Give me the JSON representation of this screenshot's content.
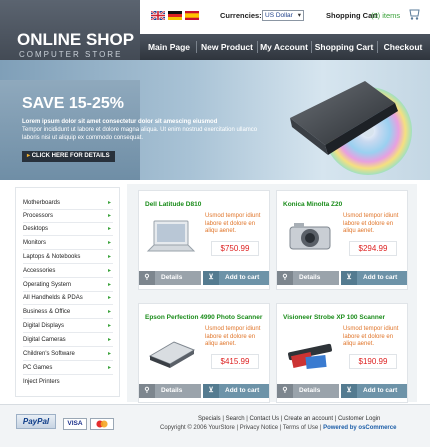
{
  "header": {
    "logo_title": "ONLINE SHOP",
    "logo_subtitle": "COMPUTER STORE",
    "currencies_label": "Currencies:",
    "currency_selected": "US Dollar",
    "cart_label": "Shopping Cart",
    "cart_count": "(0) items",
    "flags": [
      "uk-flag-icon",
      "germany-flag-icon",
      "spain-flag-icon"
    ]
  },
  "nav": {
    "items": [
      {
        "label": "Main Page"
      },
      {
        "label": "New Product"
      },
      {
        "label": "My Account"
      },
      {
        "label": "Shopping Cart"
      },
      {
        "label": "Checkout"
      }
    ]
  },
  "banner": {
    "headline": "SAVE 15-25%",
    "copy_bold": "Lorem ipsum dolor sit amet consectetur dolor sit amescing eiusmod",
    "copy": "Tempor incididunt ut labore et dolore magna aliqua. Ut enim nostrud exercitation ullamco laboris nisi ut aliquip ex commodo consequat.",
    "button": "CLICK HERE FOR DETAILS"
  },
  "sidebar": {
    "items": [
      {
        "label": "Motherboards"
      },
      {
        "label": "Processors"
      },
      {
        "label": "Desktops"
      },
      {
        "label": "Monitors"
      },
      {
        "label": "Laptops & Notebooks"
      },
      {
        "label": "Accessories"
      },
      {
        "label": "Operating System"
      },
      {
        "label": "All Handhelds & PDAs"
      },
      {
        "label": "Business & Office"
      },
      {
        "label": "Digital Displays"
      },
      {
        "label": "Digital Cameras"
      },
      {
        "label": "Children's Software"
      },
      {
        "label": "PC Games"
      },
      {
        "label": "Inject Printers"
      }
    ]
  },
  "products": [
    {
      "title": "Dell Latitude D810",
      "desc": "Usmod tempor idiunt labore et dolore en aliqu aenet.",
      "price": "$750.99",
      "details": "Details",
      "add": "Add to cart"
    },
    {
      "title": "Konica Minolta Z20",
      "desc": "Usmod tempor idiunt labore et dolore en aliqu aenet.",
      "price": "$294.99",
      "details": "Details",
      "add": "Add to cart"
    },
    {
      "title": "Epson Perfection 4990 Photo Scanner",
      "desc": "Usmod tempor idiunt labore et dolore en aliqu aenet.",
      "price": "$415.99",
      "details": "Details",
      "add": "Add to cart"
    },
    {
      "title": "Visioneer Strobe XP 100 Scanner",
      "desc": "Usmod tempor idiunt labore et dolore en aliqu aenet.",
      "price": "$190.99",
      "details": "Details",
      "add": "Add to cart"
    }
  ],
  "footer": {
    "paypal": "PayPal",
    "visa": "VISA",
    "links": "Specials  |  Search  |  Contact Us  |  Create an account  |  Customer Login",
    "copyright": "Copyright © 2006 YourStore | Privacy Notice | Terms of Use | ",
    "powered": "Powered by osCommerce"
  },
  "colors": {
    "accent_green": "#1a8c1a",
    "price_red": "#dd2222",
    "nav_dark": "#2f353d",
    "banner_blue": "#a9c3d6"
  }
}
